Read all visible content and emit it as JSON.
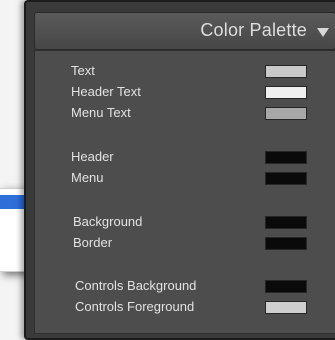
{
  "panel": {
    "title": "Color Palette",
    "groups": [
      {
        "items": [
          {
            "label": "Text",
            "color": "#c9c9c9"
          },
          {
            "label": "Header Text",
            "color": "#f0f0f0"
          },
          {
            "label": "Menu Text",
            "color": "#a8a8a8"
          }
        ]
      },
      {
        "items": [
          {
            "label": "Header",
            "color": "#0a0a0a"
          },
          {
            "label": "Menu",
            "color": "#0a0a0a"
          }
        ]
      },
      {
        "items": [
          {
            "label": "Background",
            "color": "#0a0a0a"
          },
          {
            "label": "Border",
            "color": "#0a0a0a"
          }
        ]
      },
      {
        "items": [
          {
            "label": "Controls Background",
            "color": "#0a0a0a"
          },
          {
            "label": "Controls Foreground",
            "color": "#cfcfcf"
          }
        ]
      }
    ]
  },
  "overlay": {
    "selection_color": "#2e6ed8"
  }
}
